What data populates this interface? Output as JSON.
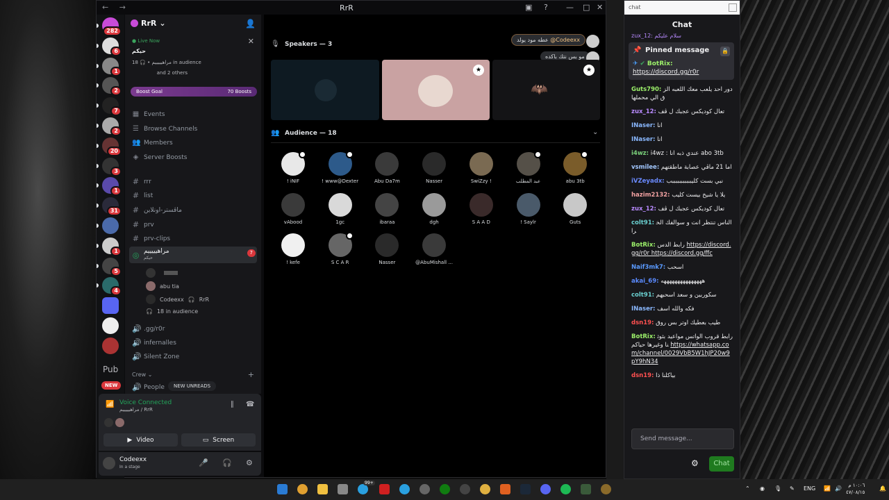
{
  "window": {
    "title": "RrR"
  },
  "guilds": [
    {
      "badge": "282"
    },
    {
      "badge": "6"
    },
    {
      "badge": "1"
    },
    {
      "badge": "2"
    },
    {
      "badge": "7"
    },
    {
      "badge": "2"
    },
    {
      "badge": "20"
    },
    {
      "badge": "3"
    },
    {
      "badge": "1"
    },
    {
      "badge": "31"
    },
    {
      "badge": ""
    },
    {
      "badge": "1"
    },
    {
      "badge": "5"
    },
    {
      "badge": "4"
    },
    {
      "badge": ""
    },
    {
      "badge": ""
    },
    {
      "badge": ""
    }
  ],
  "guilds_pub": "Pub",
  "guilds_new": "NEW",
  "server": {
    "name": "RrR",
    "live_label": "Live Now",
    "event_title": "حيكم",
    "event_meta": "مراهيييييم • 🎧 18 in audience",
    "event_others": "and 2 others",
    "boost_goal": "Boost Goal",
    "boost_count": "70 Boosts",
    "menu": [
      {
        "label": "Events",
        "icon": "calendar-icon"
      },
      {
        "label": "Browse Channels",
        "icon": "browse-icon"
      },
      {
        "label": "Members",
        "icon": "members-icon"
      },
      {
        "label": "Server Boosts",
        "icon": "boost-icon"
      }
    ],
    "text_channels": [
      "rrr",
      "list",
      "ماڤستر-اونلاين",
      "prv",
      "prv-clips"
    ],
    "active_channel": {
      "name": "مراهيييييم",
      "sub": "حيكم",
      "badge": "7"
    },
    "voice_users": [
      {
        "name": ""
      },
      {
        "name": "abu tia"
      },
      {
        "name": "Codeexx",
        "tag": "RrR"
      }
    ],
    "audience_count": "18 in audience",
    "other_channels": [
      ".gg/r0r",
      "infernalles",
      "Silent Zone"
    ],
    "category": "Crew",
    "people_channel": "People",
    "new_unreads": "NEW UNREADS"
  },
  "voice_panel": {
    "status": "Voice Connected",
    "channel": "مراهيييييم / RrR",
    "video_label": "Video",
    "screen_label": "Screen"
  },
  "user_panel": {
    "name": "Codeexx",
    "status": "In a stage"
  },
  "stage": {
    "speakers_label": "Speakers — 3",
    "audience_label": "Audience — 18",
    "bubble_name": "@Codeexx",
    "bubble_text": "عطه مود يولد",
    "bubble_text2": "مو بس نتك باكده",
    "audience": [
      {
        "name": "! iNIF",
        "color": "#e8e8e8",
        "mod": true
      },
      {
        "name": "! www@Dexter",
        "color": "#2d5a8a",
        "mod": true
      },
      {
        "name": "Abu Da7m",
        "color": "#3a3a3a",
        "mod": false
      },
      {
        "name": "Nasser",
        "color": "#2a2a2a",
        "mod": false
      },
      {
        "name": "SwiZzy !",
        "color": "#7a6a52",
        "mod": false
      },
      {
        "name": "عبد المطلب",
        "color": "#555048",
        "mod": true
      },
      {
        "name": "abu 3tb",
        "color": "#7a5c2a",
        "mod": true
      },
      {
        "name": "vAbood",
        "color": "#3a3a3a",
        "mod": false
      },
      {
        "name": "1gc",
        "color": "#d9d9d9",
        "mod": false
      },
      {
        "name": "ibaraa",
        "color": "#444",
        "mod": false
      },
      {
        "name": "dgh",
        "color": "#9a9a9a",
        "mod": false
      },
      {
        "name": "S A A D",
        "color": "#3a2a2a",
        "mod": false
      },
      {
        "name": "! Saylr",
        "color": "#4a5a6a",
        "mod": false
      },
      {
        "name": "Guts",
        "color": "#c8c8c8",
        "mod": false
      },
      {
        "name": "! kefe",
        "color": "#f0f0f0",
        "mod": false
      },
      {
        "name": "S C A R",
        "color": "#666",
        "mod": true
      },
      {
        "name": "Nasser",
        "color": "#2a2a2a",
        "mod": false
      },
      {
        "name": "@AbuMishall ...",
        "color": "#3a3a3a",
        "mod": false
      }
    ]
  },
  "chat": {
    "window_title": "chat",
    "header": "Chat",
    "pinned_label": "Pinned message",
    "pinned_user": "BotRix:",
    "pinned_link": "https://discord.gg/r0r",
    "scrolled_top": "zux_12: سلام عليكم",
    "messages": [
      {
        "user": "Guts790:",
        "color": "#9cf06a",
        "text": "دور احد يلعب معك اللعبه الزق الي محملها"
      },
      {
        "user": "zux_12:",
        "color": "#b88aff",
        "text": "تعال كوديكس عجبك ل ڤف"
      },
      {
        "user": "INaser:",
        "color": "#8ab8ff",
        "text": "انا"
      },
      {
        "user": "INaser:",
        "color": "#8ab8ff",
        "text": "انا"
      },
      {
        "user": "i4wz:",
        "color": "#7ad07a",
        "text": "i4wz : عندي ذبه انا abo 3tb"
      },
      {
        "user": "vsmilee:",
        "color": "#a3c8ff",
        "text": "اما 21 ماڤي عصابة ماطقتهم"
      },
      {
        "user": "iVZeyadx:",
        "color": "#6a8aff",
        "text": "نبي بست كليبببببببببببب"
      },
      {
        "user": "hazim2132:",
        "color": "#f0a0a0",
        "text": "يلا يا شيخ بيست كليب"
      },
      {
        "user": "zux_12:",
        "color": "#b88aff",
        "text": "تعال كوديكس عجبك ل ڤف"
      },
      {
        "user": "colt91:",
        "color": "#6ad0d0",
        "text": "الناس تنتظر انت و سوالفك الخرا"
      },
      {
        "user": "BotRix:",
        "color": "#9cf06a",
        "text": "رابط الدس",
        "link": "https://discord.gg/r0r  https://discord.gg/ffc"
      },
      {
        "user": "Naif3mk7:",
        "color": "#5a9aff",
        "text": "اسحب"
      },
      {
        "user": "akai_69:",
        "color": "#5a8aff",
        "text": "هههههههههههههههه"
      },
      {
        "user": "colt91:",
        "color": "#6ad0d0",
        "text": "سكوربين و سعد اسحبهم"
      },
      {
        "user": "INaser:",
        "color": "#8ab8ff",
        "text": "فكه والله اسف"
      },
      {
        "user": "dsn19:",
        "color": "#ff5050",
        "text": "طيب بعطيك اوتر بس روق"
      },
      {
        "user": "BotRix:",
        "color": "#9cf06a",
        "text": "رابط قروب الواتس مواعيد بثوثنا وغيرها حياكم",
        "link": "https://whatsapp.com/channel/0029VbB5W1hJP20w9pY9hN34"
      },
      {
        "user": "dsn19:",
        "color": "#ff5050",
        "text": "بياكلنا ذا"
      }
    ],
    "send_placeholder": "Send message...",
    "send_button": "Chat"
  },
  "taskbar": {
    "lang": "ENG",
    "time": "١٠:٠٦ م",
    "date": "٤٧/٠٨/١٥",
    "badge": "99+"
  }
}
